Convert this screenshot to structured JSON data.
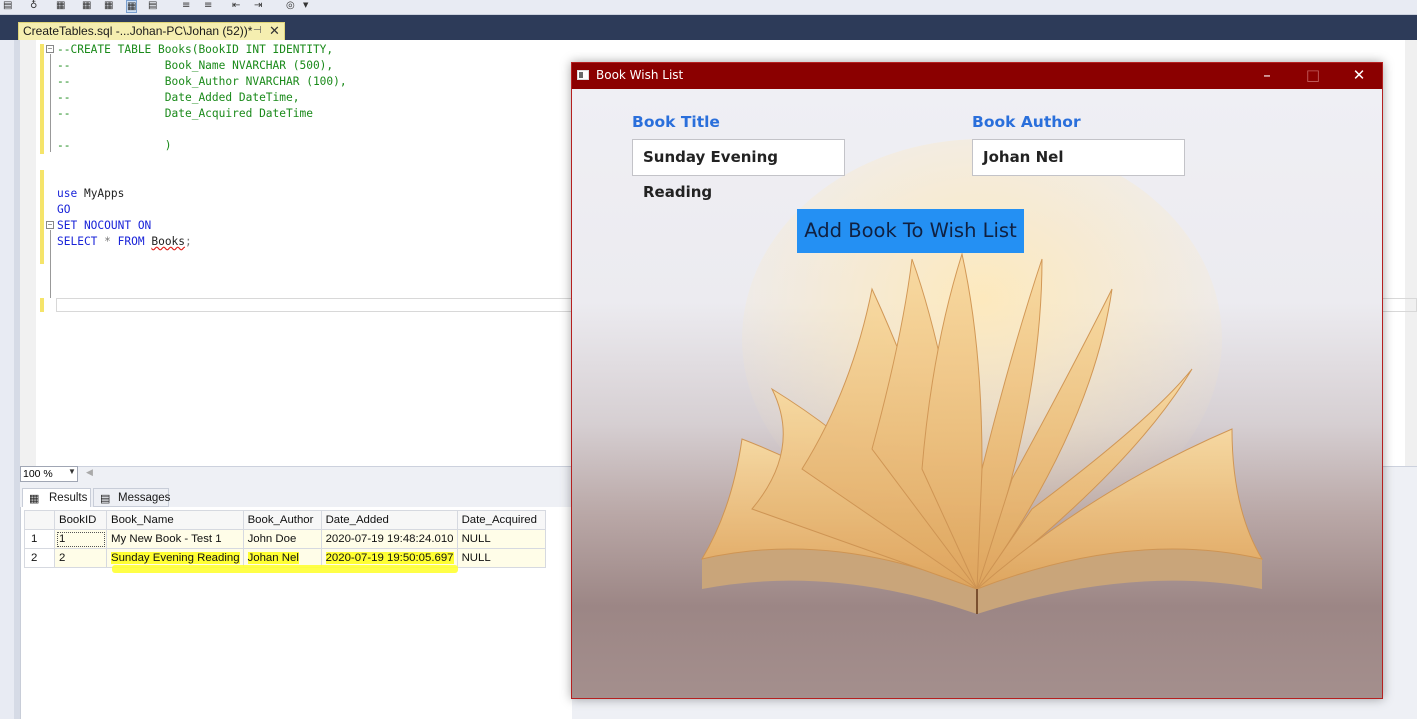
{
  "ide": {
    "tab": {
      "title": "CreateTables.sql -...Johan-PC\\Johan (52))*",
      "pin_icon": "pin-icon",
      "close_icon": "close-icon"
    },
    "code": {
      "l1": "--CREATE TABLE Books(BookID INT IDENTITY,",
      "l2": "--              Book_Name NVARCHAR (500),",
      "l3": "--              Book_Author NVARCHAR (100),",
      "l4": "--              Date_Added DateTime,",
      "l5": "--              Date_Acquired DateTime",
      "l6": "--              )",
      "l7a": "use",
      "l7b": " MyApps",
      "l8": "GO",
      "l9": "SET NOCOUNT ON",
      "l10a": "SELECT",
      "l10b": " * ",
      "l10c": "FROM",
      "l10d": "Books",
      "l10e": ";"
    },
    "zoom": {
      "value": "100 %"
    },
    "results_tabs": {
      "results": "Results",
      "messages": "Messages"
    },
    "grid": {
      "headers": [
        "",
        "BookID",
        "Book_Name",
        "Book_Author",
        "Date_Added",
        "Date_Acquired"
      ],
      "rows": [
        [
          "1",
          "1",
          "My New Book - Test 1",
          "John Doe",
          "2020-07-19 19:48:24.010",
          "NULL"
        ],
        [
          "2",
          "2",
          "Sunday Evening Reading",
          "Johan Nel",
          "2020-07-19 19:50:05.697",
          "NULL"
        ]
      ]
    }
  },
  "app": {
    "title": "Book Wish List",
    "window_controls": {
      "minimize": "–",
      "maximize": "□",
      "close": "✕"
    },
    "book_title_label": "Book Title",
    "book_title_value": "Sunday Evening Reading",
    "book_author_label": "Book Author",
    "book_author_value": "Johan Nel",
    "add_button": "Add Book To Wish List"
  },
  "colors": {
    "titlebar": "#8b0000",
    "label": "#2a6fdb",
    "button": "#2490f3",
    "highlight": "#ffff33",
    "tab": "#f5eeb0"
  }
}
